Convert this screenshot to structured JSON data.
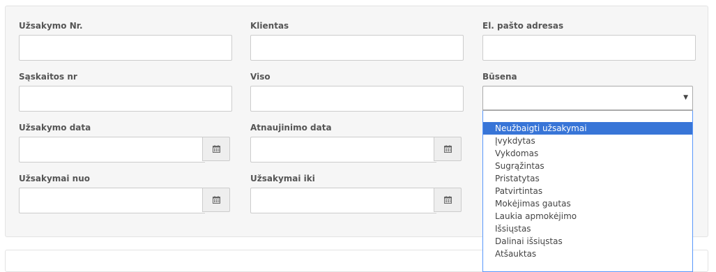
{
  "form": {
    "order_no": {
      "label": "Užsakymo Nr.",
      "value": ""
    },
    "client": {
      "label": "Klientas",
      "value": ""
    },
    "email": {
      "label": "El. pašto adresas",
      "value": ""
    },
    "invoice_no": {
      "label": "Sąskaitos nr",
      "value": ""
    },
    "total": {
      "label": "Viso",
      "value": ""
    },
    "status": {
      "label": "Būsena",
      "value": "",
      "caret_icon": "triangle-down-icon"
    },
    "order_date": {
      "label": "Užsakymo data",
      "value": "",
      "icon": "calendar-icon"
    },
    "update_date": {
      "label": "Atnaujinimo data",
      "value": "",
      "icon": "calendar-icon"
    },
    "orders_from": {
      "label": "Užsakymai nuo",
      "value": "",
      "icon": "calendar-icon"
    },
    "orders_to": {
      "label": "Užsakymai iki",
      "value": "",
      "icon": "calendar-icon"
    }
  },
  "status_dropdown": {
    "search_value": "",
    "highlighted_index": 0,
    "options": [
      "Neužbaigti užsakymai",
      "Įvykdytas",
      "Vykdomas",
      "Sugrąžintas",
      "Pristatytas",
      "Patvirtintas",
      "Mokėjimas gautas",
      "Laukia apmokėjimo",
      "Išsiųstas",
      "Dalinai išsiųstas",
      "Atšauktas"
    ]
  },
  "colors": {
    "panel_bg": "#f6f6f6",
    "highlight": "#3875d7",
    "addon_bg": "#eeeeee",
    "border": "#cccccc"
  }
}
